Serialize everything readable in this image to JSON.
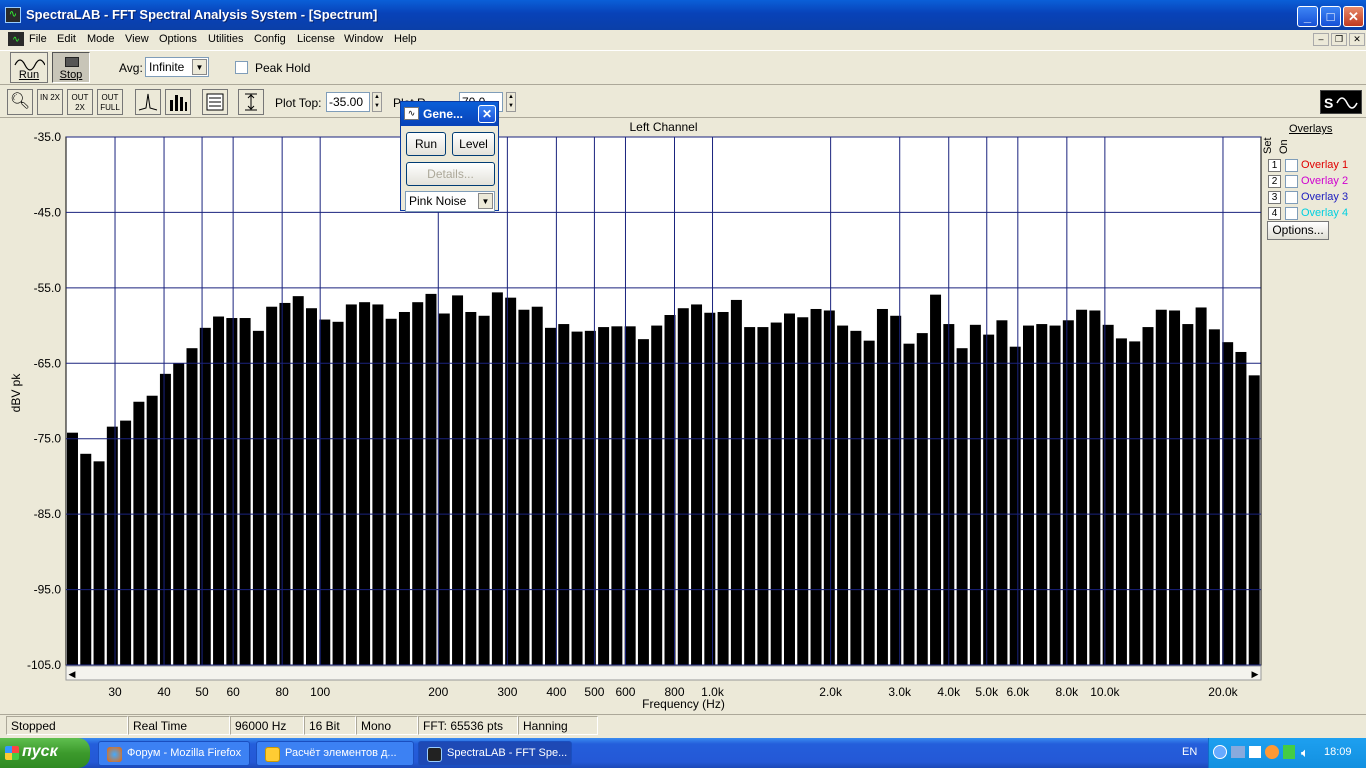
{
  "window": {
    "title": "SpectraLAB - FFT Spectral Analysis System - [Spectrum]",
    "app_icon": "spectrum-icon",
    "controls": [
      "minimize-icon",
      "maximize-icon",
      "close-icon"
    ]
  },
  "menu": [
    "File",
    "Edit",
    "Mode",
    "View",
    "Options",
    "Utilities",
    "Config",
    "License",
    "Window",
    "Help"
  ],
  "toolbar": {
    "run_label": "Run",
    "stop_label": "Stop",
    "avg_label": "Avg:",
    "avg_value": "Infinite",
    "peak_hold_label": "Peak Hold",
    "plot_top_label": "Plot Top:",
    "plot_top_value": "-35.00",
    "plot_range_label": "Plot R",
    "plot_range_value": "70.0",
    "zoom_in_label": "IN 2X",
    "zoom_out_label": "OUT 2X",
    "zoom_full_label": "OUT FULL"
  },
  "generator": {
    "title": "Gene...",
    "run": "Run",
    "level": "Level",
    "details": "Details...",
    "signal": "Pink Noise"
  },
  "plot": {
    "channel": "Left Channel",
    "ylabel": "dBV pk",
    "xlabel": "Frequency (Hz)"
  },
  "overlays": {
    "title": "Overlays",
    "set_label": "Set",
    "on_label": "On",
    "items": [
      {
        "num": "1",
        "label": "Overlay 1",
        "color": "#e00000"
      },
      {
        "num": "2",
        "label": "Overlay 2",
        "color": "#d000d0"
      },
      {
        "num": "3",
        "label": "Overlay 3",
        "color": "#2020c0"
      },
      {
        "num": "4",
        "label": "Overlay 4",
        "color": "#00d0e0"
      }
    ],
    "options": "Options..."
  },
  "status": [
    "Stopped",
    "Real Time",
    "96000 Hz",
    "16 Bit",
    "Mono",
    "FFT: 65536 pts",
    "Hanning"
  ],
  "taskbar": {
    "start": "пуск",
    "tasks": [
      "Форум - Mozilla Firefox",
      "Расчёт элементов д...",
      "SpectraLAB - FFT Spe..."
    ],
    "lang": "EN",
    "clock": "18:09"
  },
  "chart_data": {
    "type": "bar",
    "ylabel": "dBV pk",
    "xlabel": "Frequency (Hz)",
    "ylim": [
      -105,
      -35
    ],
    "y_ticks": [
      "-35.0",
      "-45.0",
      "-55.0",
      "-65.0",
      "-75.0",
      "-85.0",
      "-95.0",
      "-105.0"
    ],
    "x_ticks": [
      "30",
      "40",
      "50",
      "60",
      "80",
      "100",
      "200",
      "300",
      "400",
      "500",
      "600",
      "800",
      "1.0k",
      "2.0k",
      "3.0k",
      "4.0k",
      "5.0k",
      "6.0k",
      "8.0k",
      "10.0k",
      "20.0k"
    ],
    "x_tick_values": [
      30,
      40,
      50,
      60,
      80,
      100,
      200,
      300,
      400,
      500,
      600,
      800,
      1000,
      2000,
      3000,
      4000,
      5000,
      6000,
      8000,
      10000,
      20000
    ],
    "x_range_hz": [
      22.5,
      25000
    ],
    "values": [
      -74.2,
      -77.0,
      -78.0,
      -73.4,
      -72.6,
      -70.1,
      -69.3,
      -66.4,
      -65.0,
      -63.0,
      -60.3,
      -58.8,
      -59.0,
      -59.0,
      -60.7,
      -57.5,
      -57.0,
      -56.1,
      -57.7,
      -59.2,
      -59.5,
      -57.2,
      -56.9,
      -57.2,
      -59.1,
      -58.2,
      -56.9,
      -55.8,
      -58.4,
      -56.0,
      -58.2,
      -58.7,
      -55.6,
      -56.3,
      -57.9,
      -57.5,
      -60.3,
      -59.8,
      -60.8,
      -60.7,
      -60.2,
      -60.1,
      -60.1,
      -61.8,
      -60.0,
      -58.6,
      -57.7,
      -57.2,
      -58.3,
      -58.2,
      -56.6,
      -60.2,
      -60.2,
      -59.6,
      -58.4,
      -58.9,
      -57.8,
      -58.0,
      -60.0,
      -60.7,
      -62.0,
      -57.8,
      -58.7,
      -62.4,
      -61.0,
      -55.9,
      -59.8,
      -63.0,
      -59.9,
      -61.2,
      -59.3,
      -62.8,
      -60.0,
      -59.8,
      -60.0,
      -59.3,
      -57.9,
      -58.0,
      -59.9,
      -61.7,
      -62.1,
      -60.2,
      -57.9,
      -58.0,
      -59.8,
      -57.6,
      -60.5,
      -62.2,
      -63.5,
      -66.6
    ]
  }
}
